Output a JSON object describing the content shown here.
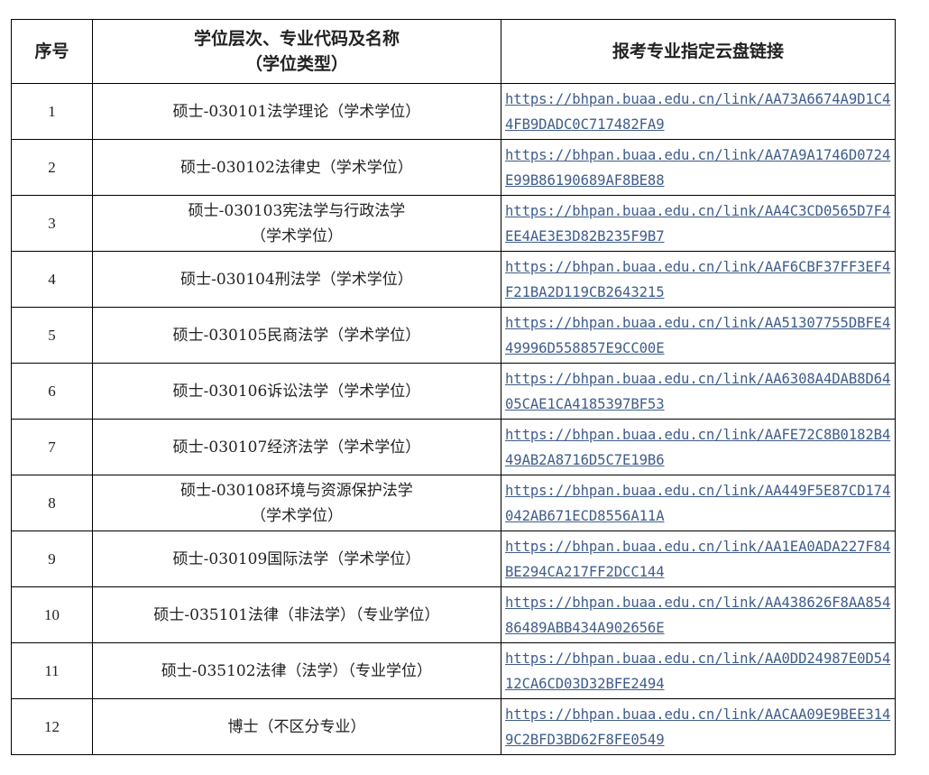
{
  "header": {
    "col_index": "序号",
    "col_major_line1": "学位层次、专业代码及名称",
    "col_major_line2": "（学位类型）",
    "col_link": "报考专业指定云盘链接"
  },
  "rows": [
    {
      "index": "1",
      "major_line1": "硕士-030101法学理论（学术学位）",
      "major_line2": "",
      "link": "https://bhpan.buaa.edu.cn/link/AA73A6674A9D1C44FB9DADC0C717482FA9"
    },
    {
      "index": "2",
      "major_line1": "硕士-030102法律史（学术学位）",
      "major_line2": "",
      "link": "https://bhpan.buaa.edu.cn/link/AA7A9A1746D0724E99B86190689AF8BE88"
    },
    {
      "index": "3",
      "major_line1": "硕士-030103宪法学与行政法学",
      "major_line2": "（学术学位）",
      "link": "https://bhpan.buaa.edu.cn/link/AA4C3CD0565D7F4EE4AE3E3D82B235F9B7"
    },
    {
      "index": "4",
      "major_line1": "硕士-030104刑法学（学术学位）",
      "major_line2": "",
      "link": "https://bhpan.buaa.edu.cn/link/AAF6CBF37FF3EF4F21BA2D119CB2643215"
    },
    {
      "index": "5",
      "major_line1": "硕士-030105民商法学（学术学位）",
      "major_line2": "",
      "link": "https://bhpan.buaa.edu.cn/link/AA51307755DBFE449996D558857E9CC00E"
    },
    {
      "index": "6",
      "major_line1": "硕士-030106诉讼法学（学术学位）",
      "major_line2": "",
      "link": "https://bhpan.buaa.edu.cn/link/AA6308A4DAB8D6405CAE1CA4185397BF53"
    },
    {
      "index": "7",
      "major_line1": "硕士-030107经济法学（学术学位）",
      "major_line2": "",
      "link": "https://bhpan.buaa.edu.cn/link/AAFE72C8B0182B449AB2A8716D5C7E19B6"
    },
    {
      "index": "8",
      "major_line1": "硕士-030108环境与资源保护法学",
      "major_line2": "（学术学位）",
      "link": "https://bhpan.buaa.edu.cn/link/AA449F5E87CD174042AB671ECD8556A11A"
    },
    {
      "index": "9",
      "major_line1": "硕士-030109国际法学（学术学位）",
      "major_line2": "",
      "link": "https://bhpan.buaa.edu.cn/link/AA1EA0ADA227F84BE294CA217FF2DCC144"
    },
    {
      "index": "10",
      "major_line1": "硕士-035101法律（非法学）（专业学位）",
      "major_line2": "",
      "link": "https://bhpan.buaa.edu.cn/link/AA438626F8AA85486489ABB434A902656E"
    },
    {
      "index": "11",
      "major_line1": "硕士-035102法律（法学）（专业学位）",
      "major_line2": "",
      "link": "https://bhpan.buaa.edu.cn/link/AA0DD24987E0D5412CA6CD03D32BFE2494"
    },
    {
      "index": "12",
      "major_line1": "博士（不区分专业）",
      "major_line2": "",
      "link": "https://bhpan.buaa.edu.cn/link/AACAA09E9BEE3149C2BFD3BD62F8FE0549"
    }
  ],
  "colors": {
    "link": "#3f5d8a",
    "text": "#222222",
    "border": "#000000"
  }
}
